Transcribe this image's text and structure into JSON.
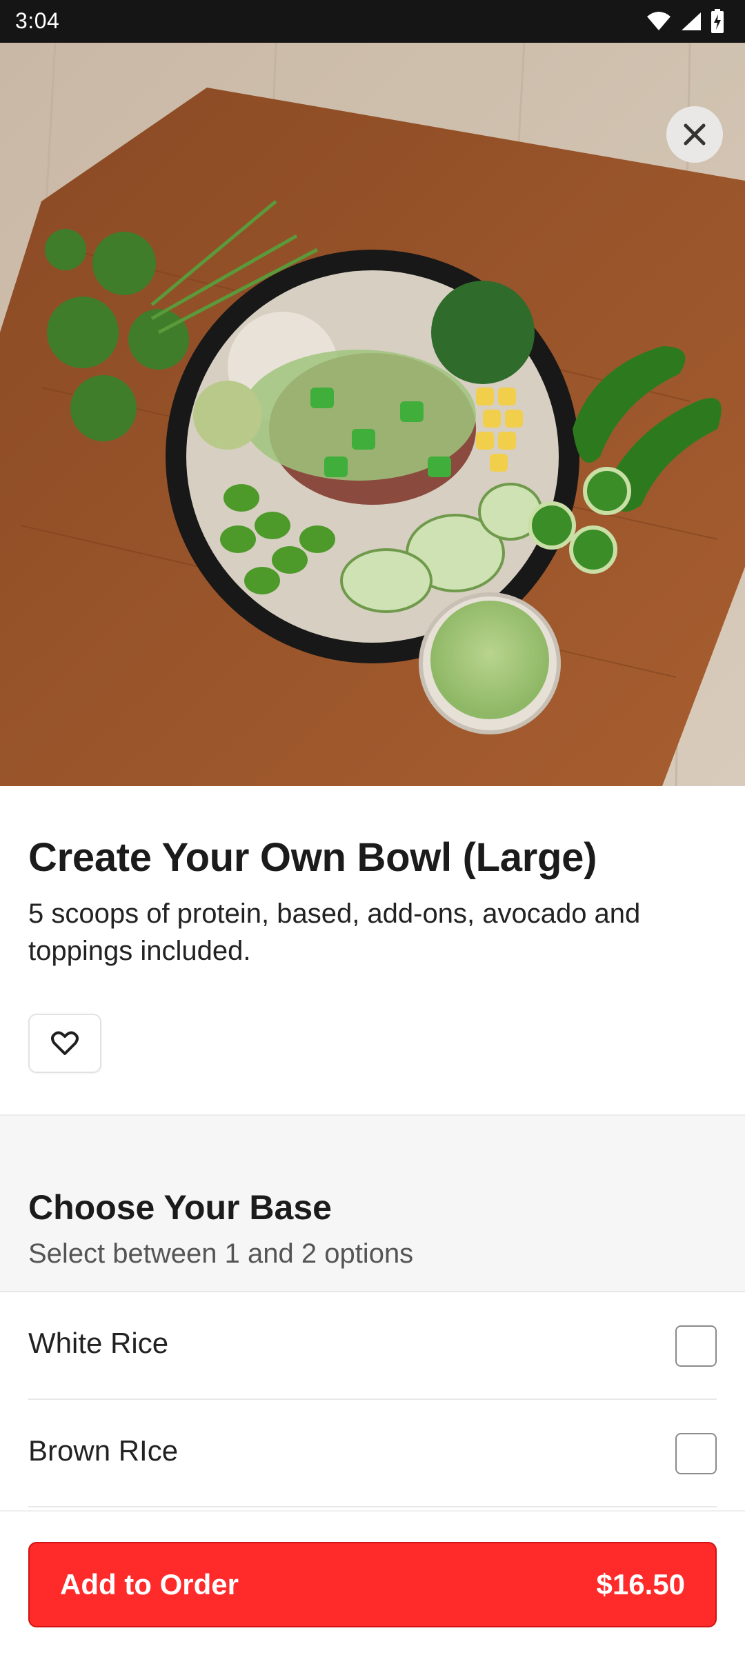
{
  "status_bar": {
    "time": "3:04",
    "icons": [
      "wifi-icon",
      "signal-icon",
      "battery-charging-icon"
    ]
  },
  "hero": {
    "image": "poke-bowl-photo",
    "close_icon": "close-icon"
  },
  "item": {
    "title": "Create Your Own Bowl (Large)",
    "description": "5 scoops of protein, based, add-ons, avocado and toppings included.",
    "favorite_icon": "heart-icon"
  },
  "section": {
    "title": "Choose Your Base",
    "subtitle": "Select between 1 and 2 options",
    "options": [
      {
        "label": "White Rice",
        "checked": false
      },
      {
        "label": "Brown RIce",
        "checked": false
      }
    ]
  },
  "order": {
    "button_label": "Add to Order",
    "price": "$16.50",
    "accent_color": "#ff2a2a"
  }
}
